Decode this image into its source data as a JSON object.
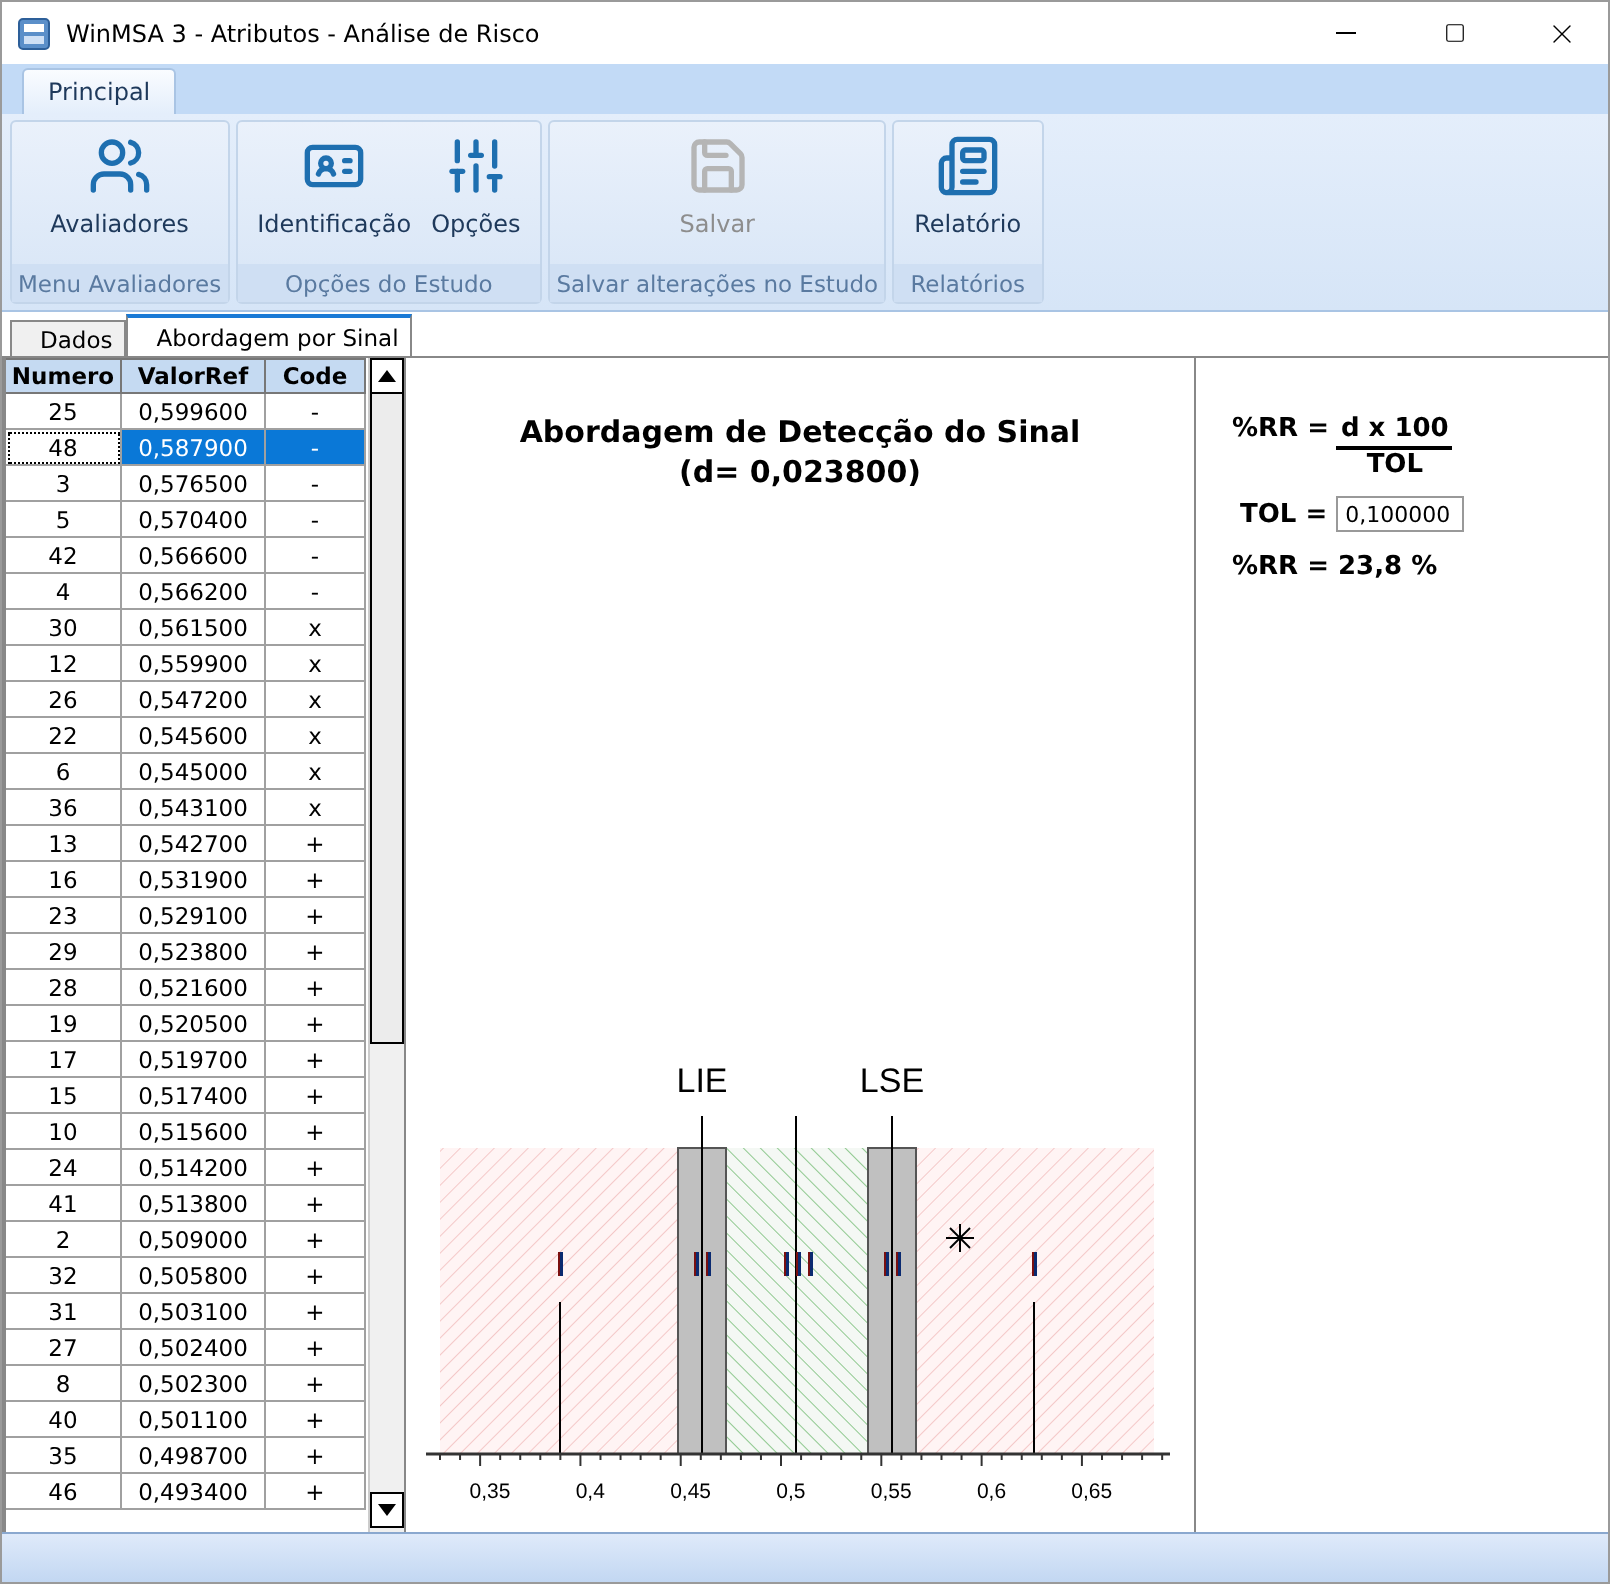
{
  "window": {
    "title": "WinMSA 3 - Atributos - Análise de Risco"
  },
  "ribbon": {
    "tabs": [
      {
        "label": "Principal",
        "selected": true
      }
    ],
    "groups": [
      {
        "label": "Menu Avaliadores",
        "buttons": [
          {
            "label": "Avaliadores",
            "kind": "people",
            "disabled": false
          }
        ]
      },
      {
        "label": "Opções do Estudo",
        "buttons": [
          {
            "label": "Identificação",
            "kind": "idcard",
            "disabled": false
          },
          {
            "label": "Opções",
            "kind": "sliders",
            "disabled": false
          }
        ]
      },
      {
        "label": "Salvar alterações no Estudo",
        "buttons": [
          {
            "label": "Salvar",
            "kind": "save",
            "disabled": true
          }
        ]
      },
      {
        "label": "Relatórios",
        "buttons": [
          {
            "label": "Relatório",
            "kind": "report",
            "disabled": false
          }
        ]
      }
    ]
  },
  "doc_tabs": [
    {
      "label": "Dados",
      "selected": false
    },
    {
      "label": "Abordagem por Sinal",
      "selected": true
    }
  ],
  "table": {
    "columns": [
      "Numero",
      "ValorRef",
      "Code"
    ],
    "rows": [
      {
        "cells": [
          "25",
          "0,599600",
          "-"
        ],
        "selected": false
      },
      {
        "cells": [
          "48",
          "0,587900",
          "-"
        ],
        "selected": true
      },
      {
        "cells": [
          "3",
          "0,576500",
          "-"
        ],
        "selected": false
      },
      {
        "cells": [
          "5",
          "0,570400",
          "-"
        ],
        "selected": false
      },
      {
        "cells": [
          "42",
          "0,566600",
          "-"
        ],
        "selected": false
      },
      {
        "cells": [
          "4",
          "0,566200",
          "-"
        ],
        "selected": false
      },
      {
        "cells": [
          "30",
          "0,561500",
          "x"
        ],
        "selected": false
      },
      {
        "cells": [
          "12",
          "0,559900",
          "x"
        ],
        "selected": false
      },
      {
        "cells": [
          "26",
          "0,547200",
          "x"
        ],
        "selected": false
      },
      {
        "cells": [
          "22",
          "0,545600",
          "x"
        ],
        "selected": false
      },
      {
        "cells": [
          "6",
          "0,545000",
          "x"
        ],
        "selected": false
      },
      {
        "cells": [
          "36",
          "0,543100",
          "x"
        ],
        "selected": false
      },
      {
        "cells": [
          "13",
          "0,542700",
          "+"
        ],
        "selected": false
      },
      {
        "cells": [
          "16",
          "0,531900",
          "+"
        ],
        "selected": false
      },
      {
        "cells": [
          "23",
          "0,529100",
          "+"
        ],
        "selected": false
      },
      {
        "cells": [
          "29",
          "0,523800",
          "+"
        ],
        "selected": false
      },
      {
        "cells": [
          "28",
          "0,521600",
          "+"
        ],
        "selected": false
      },
      {
        "cells": [
          "19",
          "0,520500",
          "+"
        ],
        "selected": false
      },
      {
        "cells": [
          "17",
          "0,519700",
          "+"
        ],
        "selected": false
      },
      {
        "cells": [
          "15",
          "0,517400",
          "+"
        ],
        "selected": false
      },
      {
        "cells": [
          "10",
          "0,515600",
          "+"
        ],
        "selected": false
      },
      {
        "cells": [
          "24",
          "0,514200",
          "+"
        ],
        "selected": false
      },
      {
        "cells": [
          "41",
          "0,513800",
          "+"
        ],
        "selected": false
      },
      {
        "cells": [
          "2",
          "0,509000",
          "+"
        ],
        "selected": false
      },
      {
        "cells": [
          "32",
          "0,505800",
          "+"
        ],
        "selected": false
      },
      {
        "cells": [
          "31",
          "0,503100",
          "+"
        ],
        "selected": false
      },
      {
        "cells": [
          "27",
          "0,502400",
          "+"
        ],
        "selected": false
      },
      {
        "cells": [
          "8",
          "0,502300",
          "+"
        ],
        "selected": false
      },
      {
        "cells": [
          "40",
          "0,501100",
          "+"
        ],
        "selected": false
      },
      {
        "cells": [
          "35",
          "0,498700",
          "+"
        ],
        "selected": false
      },
      {
        "cells": [
          "46",
          "0,493400",
          "+"
        ],
        "selected": false
      }
    ]
  },
  "chart": {
    "title": "Abordagem de Detecção do Sinal",
    "subtitle": "(d= 0,023800)",
    "limit_labels": [
      "LIE",
      "LSE"
    ],
    "axis_labels": [
      "0,35",
      "0,4",
      "0,45",
      "0,5",
      "0,55",
      "0,6",
      "0,65"
    ]
  },
  "formula": {
    "lhs": "%RR =",
    "numerator": "d x 100",
    "denominator": "TOL",
    "tol_label": "TOL =",
    "tol_value": "0,100000",
    "result": "%RR = 23,8 %"
  }
}
